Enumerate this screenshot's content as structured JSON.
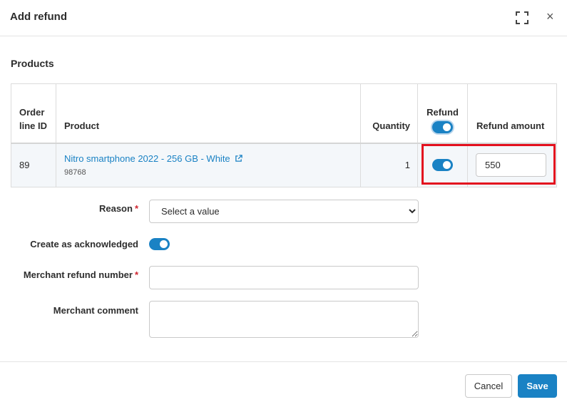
{
  "dialog": {
    "title": "Add refund",
    "expand_icon": "expand-icon",
    "close_glyph": "×"
  },
  "products": {
    "section_title": "Products",
    "columns": {
      "order_line_id": "Order line ID",
      "product": "Product",
      "quantity": "Quantity",
      "refund": "Refund",
      "refund_amount": "Refund amount"
    },
    "refund_all_toggle": true,
    "rows": [
      {
        "order_line_id": "89",
        "product_name": "Nitro smartphone 2022 - 256 GB - White",
        "sku": "98768",
        "quantity": "1",
        "refund": true,
        "refund_amount": "550"
      }
    ]
  },
  "form": {
    "reason_label": "Reason",
    "reason_value": "Select a value",
    "required_mark": "*",
    "acknowledged_label": "Create as acknowledged",
    "acknowledged": true,
    "merchant_refund_number_label": "Merchant refund number",
    "merchant_refund_number_value": "",
    "merchant_comment_label": "Merchant comment",
    "merchant_comment_value": ""
  },
  "footer": {
    "cancel_label": "Cancel",
    "save_label": "Save"
  },
  "colors": {
    "accent": "#1a82c4",
    "highlight": "#e3101e",
    "required": "#d0252f"
  }
}
